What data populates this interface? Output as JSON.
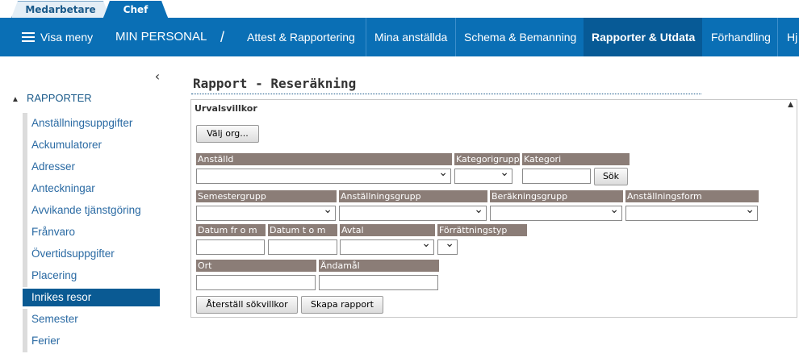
{
  "role_tabs": [
    {
      "label": "Medarbetare"
    },
    {
      "label": "Chef"
    }
  ],
  "navbar": {
    "menu_label": "Visa meny",
    "section_label": "MIN PERSONAL",
    "separator": "/",
    "items": [
      {
        "label": "Attest & Rapportering"
      },
      {
        "label": "Mina anställda"
      },
      {
        "label": "Schema & Bemanning"
      },
      {
        "label": "Rapporter & Utdata"
      },
      {
        "label": "Förhandling"
      },
      {
        "label": "Hj"
      }
    ]
  },
  "sidebar": {
    "collapse_icon": "chevron-left-icon",
    "collapse_glyph": "‹",
    "section_caret": "▲",
    "section_title": "RAPPORTER",
    "items": [
      {
        "label": "Anställningsuppgifter"
      },
      {
        "label": "Ackumulatorer"
      },
      {
        "label": "Adresser"
      },
      {
        "label": "Anteckningar"
      },
      {
        "label": "Avvikande tjänstgöring"
      },
      {
        "label": "Frånvaro"
      },
      {
        "label": "Övertidsuppgifter"
      },
      {
        "label": "Placering"
      },
      {
        "label": "Inrikes resor"
      },
      {
        "label": "Semester"
      },
      {
        "label": "Ferier"
      }
    ]
  },
  "main": {
    "title": "Rapport - Reseräkning",
    "panel_title": "Urvalsvillkor",
    "panel_toggle": "▲",
    "select_org_button": "Välj org...",
    "search_button": "Sök",
    "reset_button": "Återställ sökvillkor",
    "create_report_button": "Skapa rapport",
    "fields": {
      "anstalld": {
        "label": "Anställd",
        "value": ""
      },
      "kategorigrupp": {
        "label": "Kategorigrupp",
        "value": ""
      },
      "kategori": {
        "label": "Kategori",
        "value": ""
      },
      "semestergrupp": {
        "label": "Semestergrupp",
        "value": ""
      },
      "anstallningsgrupp": {
        "label": "Anställningsgrupp",
        "value": ""
      },
      "berakningsgrupp": {
        "label": "Beräkningsgrupp",
        "value": ""
      },
      "anstallningsform": {
        "label": "Anställningsform",
        "value": ""
      },
      "datum_from": {
        "label": "Datum fr o m",
        "value": ""
      },
      "datum_tom": {
        "label": "Datum t o m",
        "value": ""
      },
      "avtal": {
        "label": "Avtal",
        "value": ""
      },
      "forrattningstyp": {
        "label": "Förrättningstyp",
        "value": ""
      },
      "ort": {
        "label": "Ort",
        "value": ""
      },
      "andamal": {
        "label": "Ändamål",
        "value": ""
      }
    }
  },
  "colors": {
    "nav_bg": "#0a6fb5",
    "nav_active_bg": "#075a96",
    "label_bg": "#8b7d77",
    "sidebar_active_bg": "#0a5a93",
    "link": "#2a6aa3"
  }
}
